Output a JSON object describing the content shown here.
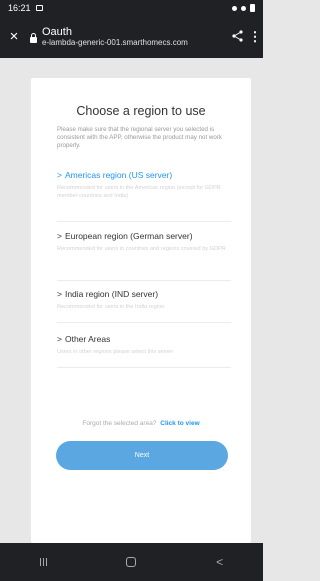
{
  "status_bar": {
    "time": "16:21"
  },
  "browser": {
    "close_icon": "×",
    "page_title": "Oauth",
    "url": "e-lambda-generic-001.smarthomecs.com",
    "share_icon": "share-icon",
    "more_icon": "more-icon"
  },
  "region_page": {
    "heading": "Choose a region to use",
    "notice": "Please make sure that the regional server you selected is consistent with the APP, otherwise the product may not work properly.",
    "regions": [
      {
        "arrow": ">",
        "label": "Americas region (US server)",
        "description": "Recommended for users in the Americas region (except for GDPR member countries and India)"
      },
      {
        "arrow": ">",
        "label": "European region (German server)",
        "description": "Recommended for users in countries and regions covered by GDPR"
      },
      {
        "arrow": ">",
        "label": "India region (IND server)",
        "description": "Recommended for users in the India region"
      },
      {
        "arrow": ">",
        "label": "Other Areas",
        "description": "Users in other regions please select this server"
      }
    ],
    "forgot_text": "Forgot the selected area?",
    "forgot_link": "Click to view",
    "next_label": "Next"
  },
  "colors": {
    "accent": "#2196f3",
    "button": "#5aa7e2",
    "chrome": "#202124"
  }
}
